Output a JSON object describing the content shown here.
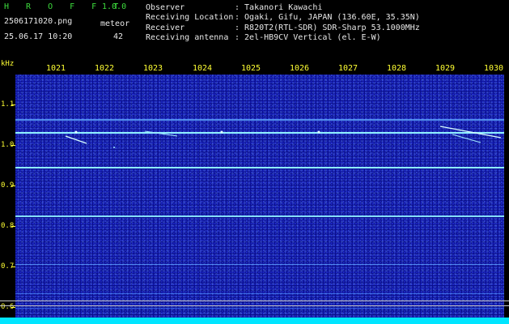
{
  "app": {
    "title": "H R O F F T",
    "version": "1.0.0"
  },
  "file": {
    "name": "2506171020.png",
    "datetime": "25.06.17 10:20"
  },
  "meteor": {
    "label": "meteor",
    "count": "42"
  },
  "info": [
    {
      "key": "Observer",
      "value": ": Takanori Kawachi"
    },
    {
      "key": "Receiving Location",
      "value": ": Ogaki, Gifu, JAPAN (136.60E, 35.35N)"
    },
    {
      "key": "Receiver",
      "value": ": R820T2(RTL-SDR) SDR-Sharp 53.1000MHz"
    },
    {
      "key": "Receiving antenna",
      "value": ": 2el-HB9CV Vertical (el. E-W)"
    }
  ],
  "y_axis": {
    "unit": "kHz",
    "ticks": [
      "1.1",
      "1.0",
      "0.9",
      "0.8",
      "0.7",
      "0.6"
    ]
  },
  "x_axis": {
    "ticks": [
      "1021",
      "1022",
      "1023",
      "1024",
      "1025",
      "1026",
      "1027",
      "1028",
      "1029",
      "1030"
    ]
  },
  "colors": {
    "header_text": "#e8e8e8",
    "title_green": "#3ddc3d",
    "axis_yellow": "#ffff33",
    "background_blue": "#0a0f8e",
    "signal_cyan": "#8ff0ff",
    "bottom_band": "#00e5ff"
  }
}
